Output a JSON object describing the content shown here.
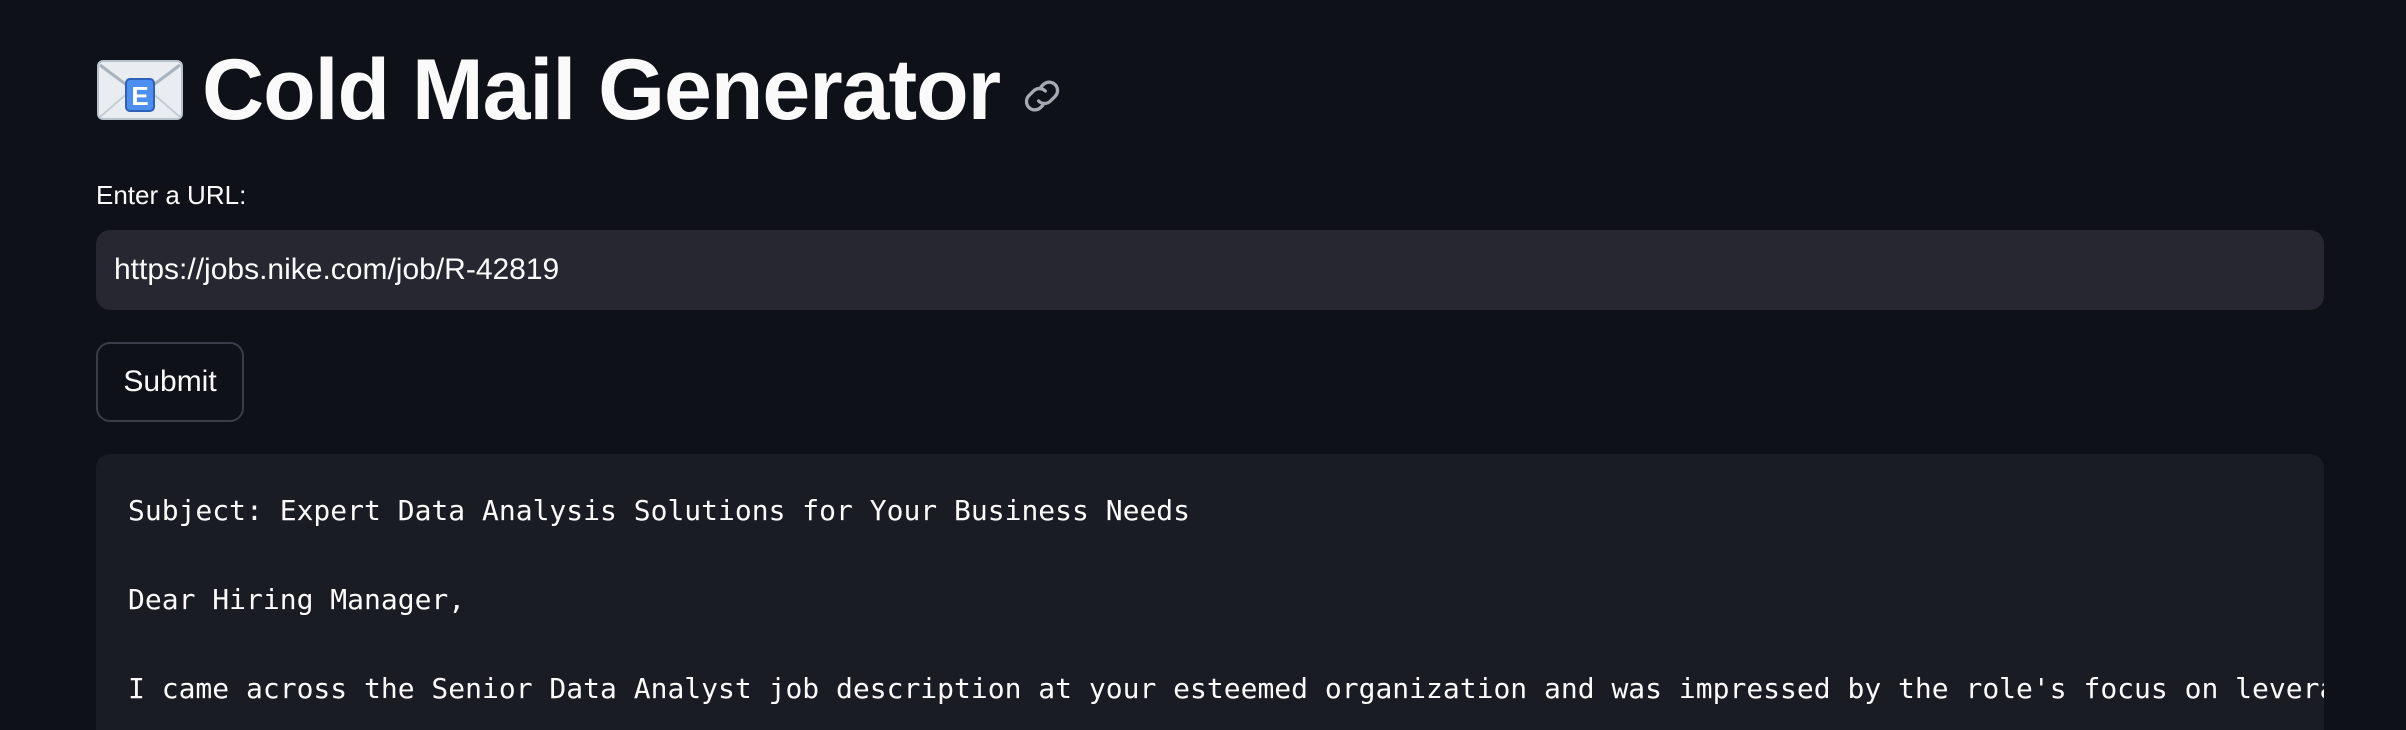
{
  "header": {
    "icon": "envelope-icon",
    "title": "Cold Mail Generator",
    "anchor_icon": "link-icon"
  },
  "form": {
    "url_label": "Enter a URL:",
    "url_value": "https://jobs.nike.com/job/R-42819",
    "submit_label": "Submit"
  },
  "output": {
    "lines": [
      "Subject: Expert Data Analysis Solutions for Your Business Needs",
      "Dear Hiring Manager,",
      "I came across the Senior Data Analyst job description at your esteemed organization and was impressed by the role's focus on levera"
    ]
  },
  "colors": {
    "background": "#0e1117",
    "input_bg": "#262730",
    "code_bg": "#1a1c23",
    "text": "#fafafa"
  }
}
